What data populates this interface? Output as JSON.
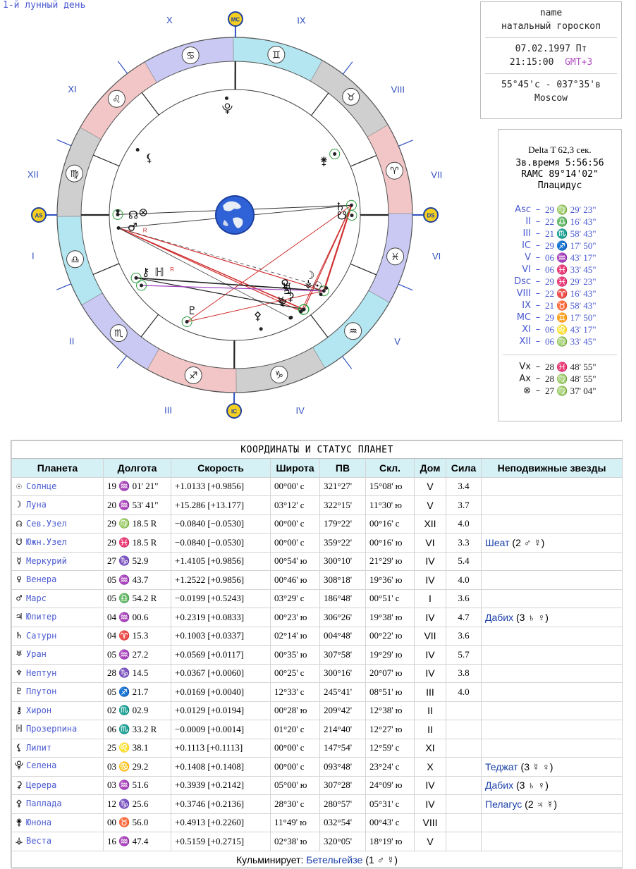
{
  "lunar_day": "1-й лунный день",
  "info": {
    "name": "name",
    "subtitle": "натальный гороскоп",
    "date": "07.02.1997 Пт",
    "time": "21:15:00",
    "gmt": "GMT+3",
    "coords": "55°45'с - 037°35'в",
    "city": "Moscow"
  },
  "delta_t": "Delta T  62,3 сек.",
  "sidereal_time": "Зв.время 5:56:56",
  "ramc": "RAMC 89°14'02\"",
  "house_system": "Плацидус",
  "cusps": [
    {
      "label": "Asc",
      "value": "29 ♍ 29' 23\""
    },
    {
      "label": "II",
      "value": "22 ♎ 16' 43\""
    },
    {
      "label": "III",
      "value": "21 ♏ 58' 43\""
    },
    {
      "label": "IC",
      "value": "29 ♐ 17' 50\""
    },
    {
      "label": "V",
      "value": "06 ♒ 43' 17\""
    },
    {
      "label": "VI",
      "value": "06 ♓ 33' 45\""
    },
    {
      "label": "Dsc",
      "value": "29 ♓ 29' 23\""
    },
    {
      "label": "VIII",
      "value": "22 ♈ 16' 43\""
    },
    {
      "label": "IX",
      "value": "21 ♉ 58' 43\""
    },
    {
      "label": "MC",
      "value": "29 ♊ 17' 50\""
    },
    {
      "label": "XI",
      "value": "06 ♌ 43' 17\""
    },
    {
      "label": "XII",
      "value": "06 ♍ 33' 45\""
    }
  ],
  "points": [
    {
      "label": "Vx",
      "value": "28 ♓ 48' 55\""
    },
    {
      "label": "Ax",
      "value": "28 ♍ 48' 55\""
    },
    {
      "label": "⊗",
      "value": "27 ♍ 37' 04\""
    }
  ],
  "wheel": {
    "angle_labels": {
      "asc": "AS",
      "dsc": "DS",
      "mc": "MC",
      "ic": "IC"
    },
    "house_numbers": [
      "I",
      "II",
      "III",
      "IV",
      "V",
      "VI",
      "VII",
      "VIII",
      "IX",
      "X",
      "XI",
      "XII"
    ],
    "sign_glyphs": [
      "♈",
      "♉",
      "♊",
      "♋",
      "♌",
      "♍",
      "♎",
      "♏",
      "♐",
      "♑",
      "♒",
      "♓"
    ],
    "retro_mark": "R"
  },
  "table": {
    "title": "КООРДИНАТЫ И СТАТУС ПЛАНЕТ",
    "headers": [
      "Планета",
      "Долгота",
      "Скорость",
      "Широта",
      "ПВ",
      "Скл.",
      "Дом",
      "Сила",
      "Неподвижные звезды"
    ],
    "rows": [
      {
        "sym": "☉",
        "name": "Солнце",
        "lon": "19 ♒ 01' 21\"",
        "speed": "+1.0133  [+0.9856]",
        "lat": "00°00' с",
        "ra": "321°27'",
        "decl": "15°08' ю",
        "house": "V",
        "power": "3.4",
        "star": "",
        "star_tail": ""
      },
      {
        "sym": "☽",
        "name": "Луна",
        "lon": "20 ♒ 53' 41\"",
        "speed": "+15.286  [+13.177]",
        "lat": "03°12' с",
        "ra": "322°15'",
        "decl": "11°30' ю",
        "house": "V",
        "power": "3.7",
        "star": "",
        "star_tail": ""
      },
      {
        "sym": "☊",
        "name": "Сев.Узел",
        "lon": "29 ♍ 18.5  R",
        "speed": "−0.0840  [−0.0530]",
        "lat": "00°00' с",
        "ra": "179°22'",
        "decl": "00°16' с",
        "house": "XII",
        "power": "4.0",
        "star": "",
        "star_tail": ""
      },
      {
        "sym": "☋",
        "name": "Южн.Узел",
        "lon": "29 ♓ 18.5  R",
        "speed": "−0.0840  [−0.0530]",
        "lat": "00°00' с",
        "ra": "359°22'",
        "decl": "00°16' ю",
        "house": "VI",
        "power": "3.3",
        "star": "Шеат",
        "star_tail": " (2 ♂ ☿)"
      },
      {
        "sym": "☿",
        "name": "Меркурий",
        "lon": "27 ♑ 52.9",
        "speed": "+1.4105  [+0.9856]",
        "lat": "00°54' ю",
        "ra": "300°10'",
        "decl": "21°29' ю",
        "house": "IV",
        "power": "5.4",
        "star": "",
        "star_tail": ""
      },
      {
        "sym": "♀",
        "name": "Венера",
        "lon": "05 ♒ 43.7",
        "speed": "+1.2522  [+0.9856]",
        "lat": "00°46' ю",
        "ra": "308°18'",
        "decl": "19°36' ю",
        "house": "IV",
        "power": "4.0",
        "star": "",
        "star_tail": ""
      },
      {
        "sym": "♂",
        "name": "Марс",
        "lon": "05 ♎ 54.2  R",
        "speed": "−0.0199  [+0.5243]",
        "lat": "03°29' с",
        "ra": "186°48'",
        "decl": "00°51' с",
        "house": "I",
        "power": "3.6",
        "star": "",
        "star_tail": ""
      },
      {
        "sym": "♃",
        "name": "Юпитер",
        "lon": "04 ♒ 00.6",
        "speed": "+0.2319  [+0.0833]",
        "lat": "00°23' ю",
        "ra": "306°26'",
        "decl": "19°38' ю",
        "house": "IV",
        "power": "4.7",
        "star": "Дабих",
        "star_tail": " (3 ♄ ♀)"
      },
      {
        "sym": "♄",
        "name": "Сатурн",
        "lon": "04 ♈ 15.3",
        "speed": "+0.1003  [+0.0337]",
        "lat": "02°14' ю",
        "ra": "004°48'",
        "decl": "00°22' ю",
        "house": "VII",
        "power": "3.6",
        "star": "",
        "star_tail": ""
      },
      {
        "sym": "♅",
        "name": "Уран",
        "lon": "05 ♒ 27.2",
        "speed": "+0.0569  [+0.0117]",
        "lat": "00°35' ю",
        "ra": "307°58'",
        "decl": "19°29' ю",
        "house": "IV",
        "power": "5.7",
        "star": "",
        "star_tail": ""
      },
      {
        "sym": "♆",
        "name": "Нептун",
        "lon": "28 ♑ 14.5",
        "speed": "+0.0367  [+0.0060]",
        "lat": "00°25' с",
        "ra": "300°16'",
        "decl": "20°07' ю",
        "house": "IV",
        "power": "3.8",
        "star": "",
        "star_tail": ""
      },
      {
        "sym": "♇",
        "name": "Плутон",
        "lon": "05 ♐ 21.7",
        "speed": "+0.0169  [+0.0040]",
        "lat": "12°33' с",
        "ra": "245°41'",
        "decl": "08°51' ю",
        "house": "III",
        "power": "4.0",
        "star": "",
        "star_tail": ""
      },
      {
        "sym": "⚷",
        "name": "Хирон",
        "lon": "02 ♏ 02.9",
        "speed": "+0.0129  [+0.0194]",
        "lat": "00°28' ю",
        "ra": "209°42'",
        "decl": "12°38' ю",
        "house": "II",
        "power": "",
        "star": "",
        "star_tail": ""
      },
      {
        "sym": "ℍ",
        "name": "Прозерпина",
        "lon": "06 ♏ 33.2  R",
        "speed": "−0.0009  [+0.0014]",
        "lat": "01°20' с",
        "ra": "214°40'",
        "decl": "12°27' ю",
        "house": "II",
        "power": "",
        "star": "",
        "star_tail": ""
      },
      {
        "sym": "⚸",
        "name": "Лилит",
        "lon": "25 ♌ 38.1",
        "speed": "+0.1113  [+0.1113]",
        "lat": "00°00' с",
        "ra": "147°54'",
        "decl": "12°59' с",
        "house": "XI",
        "power": "",
        "star": "",
        "star_tail": ""
      },
      {
        "sym": "⯓",
        "name": "Селена",
        "lon": "03 ♋ 29.2",
        "speed": "+0.1408  [+0.1408]",
        "lat": "00°00' с",
        "ra": "093°48'",
        "decl": "23°24' с",
        "house": "X",
        "power": "",
        "star": "Теджат",
        "star_tail": " (3 ☿ ♀)"
      },
      {
        "sym": "⚳",
        "name": "Церера",
        "lon": "03 ♒ 51.6",
        "speed": "+0.3939  [+0.2142]",
        "lat": "05°00' ю",
        "ra": "307°28'",
        "decl": "24°09' ю",
        "house": "IV",
        "power": "",
        "star": "Дабих",
        "star_tail": " (3 ♄ ♀)"
      },
      {
        "sym": "⚴",
        "name": "Паллада",
        "lon": "12 ♑ 25.6",
        "speed": "+0.3746  [+0.2136]",
        "lat": "28°30' с",
        "ra": "280°57'",
        "decl": "05°31' с",
        "house": "IV",
        "power": "",
        "star": "Пелагус",
        "star_tail": " (2 ♃ ☿)"
      },
      {
        "sym": "⚵",
        "name": "Юнона",
        "lon": "00 ♉ 56.0",
        "speed": "+0.4913  [+0.2260]",
        "lat": "11°49' ю",
        "ra": "032°54'",
        "decl": "00°43' с",
        "house": "VIII",
        "power": "",
        "star": "",
        "star_tail": ""
      },
      {
        "sym": "⚶",
        "name": "Веста",
        "lon": "16 ♒ 47.4",
        "speed": "+0.5159  [+0.2715]",
        "lat": "02°38' ю",
        "ra": "320°05'",
        "decl": "18°19' ю",
        "house": "V",
        "power": "",
        "star": "",
        "star_tail": ""
      }
    ],
    "footer_prefix": "Кульминирует: ",
    "footer_star": "Бетельгейзе",
    "footer_suffix": " (1 ♂ ☿)"
  },
  "colors": {
    "label_blue": "#4a5ad0",
    "star_blue": "#1a3fa8",
    "header_bg": "#d6f1f6",
    "fire": "#f2c6c6",
    "earth": "#cfcfcf",
    "air": "#b3e6f0",
    "water": "#c9c9f3"
  }
}
